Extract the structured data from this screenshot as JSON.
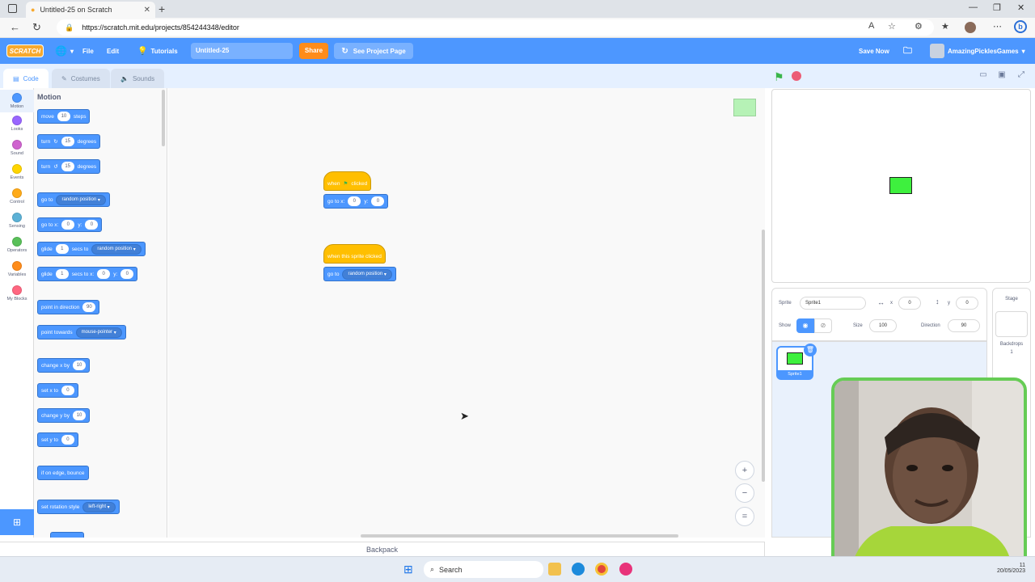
{
  "browser": {
    "tab_title": "Untitled-25 on Scratch",
    "url": "https://scratch.mit.edu/projects/854244348/editor"
  },
  "menubar": {
    "logo": "SCRATCH",
    "file": "File",
    "edit": "Edit",
    "tutorials": "Tutorials",
    "project_title": "Untitled-25",
    "share": "Share",
    "see_project_page": "See Project Page",
    "save_now": "Save Now",
    "username": "AmazingPicklesGames"
  },
  "editor_tabs": {
    "code": "Code",
    "costumes": "Costumes",
    "sounds": "Sounds"
  },
  "categories": [
    {
      "label": "Motion",
      "color": "#4c97ff"
    },
    {
      "label": "Looks",
      "color": "#9966ff"
    },
    {
      "label": "Sound",
      "color": "#cf63cf"
    },
    {
      "label": "Events",
      "color": "#ffd500"
    },
    {
      "label": "Control",
      "color": "#ffab19"
    },
    {
      "label": "Sensing",
      "color": "#5cb1d6"
    },
    {
      "label": "Operators",
      "color": "#59c059"
    },
    {
      "label": "Variables",
      "color": "#ff8c1a"
    },
    {
      "label": "My Blocks",
      "color": "#ff6680"
    }
  ],
  "palette": {
    "title": "Motion",
    "move": {
      "a": "move",
      "v": "10",
      "b": "steps"
    },
    "turn_right": {
      "a": "turn",
      "v": "15",
      "b": "degrees"
    },
    "turn_left": {
      "a": "turn",
      "v": "15",
      "b": "degrees"
    },
    "goto": {
      "a": "go to",
      "dd": "random position"
    },
    "goto_xy": {
      "a": "go to x:",
      "x": "0",
      "b": "y:",
      "y": "0"
    },
    "glide_to": {
      "a": "glide",
      "v": "1",
      "b": "secs to",
      "dd": "random position"
    },
    "glide_xy": {
      "a": "glide",
      "v": "1",
      "b": "secs to x:",
      "x": "0",
      "c": "y:",
      "y": "0"
    },
    "point_dir": {
      "a": "point in direction",
      "v": "90"
    },
    "point_towards": {
      "a": "point towards",
      "dd": "mouse-pointer"
    },
    "change_x": {
      "a": "change x by",
      "v": "10"
    },
    "set_x": {
      "a": "set x to",
      "v": "0"
    },
    "change_y": {
      "a": "change y by",
      "v": "10"
    },
    "set_y": {
      "a": "set y to",
      "v": "0"
    },
    "bounce": {
      "a": "if on edge, bounce"
    },
    "rot_style": {
      "a": "set rotation style",
      "dd": "left-right"
    }
  },
  "scripts": {
    "s1_hat_a": "when",
    "s1_hat_b": "clicked",
    "s1_goto": "go to x:",
    "s1_x": "0",
    "s1_ylabel": "y:",
    "s1_y": "0",
    "s2_hat": "when this sprite clicked",
    "s2_goto": "go to",
    "s2_dd": "random position"
  },
  "backpack": "Backpack",
  "sprite_info": {
    "sprite_label": "Sprite",
    "sprite_name": "Sprite1",
    "x_label": "x",
    "x": "0",
    "y_label": "y",
    "y": "0",
    "show_label": "Show",
    "size_label": "Size",
    "size": "100",
    "direction_label": "Direction",
    "direction": "90"
  },
  "sprite_card": "Sprite1",
  "stage_pane": {
    "title": "Stage",
    "backdrops_label": "Backdrops",
    "backdrops_count": "1"
  },
  "taskbar": {
    "search": "Search",
    "clock_time": "11",
    "clock_date": "20/05/2023"
  }
}
